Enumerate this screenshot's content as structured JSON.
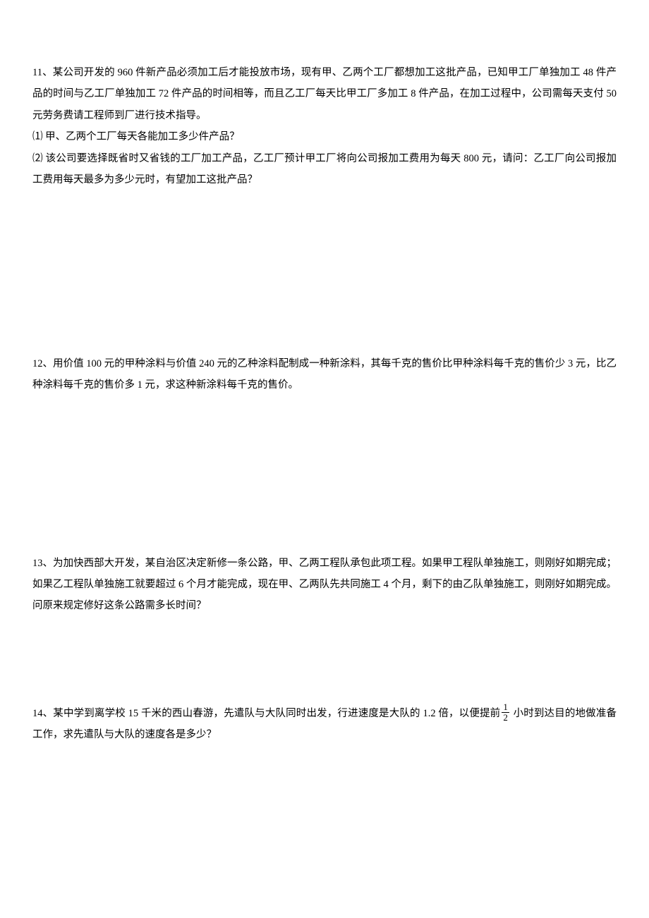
{
  "problems": {
    "p11": {
      "line1": "11、某公司开发的 960 件新产品必须加工后才能投放市场，现有甲、乙两个工厂都想加工这批产品，已知甲工厂单独加工 48 件产品的时间与乙工厂单独加工 72 件产品的时间相等，而且乙工厂每天比甲工厂多加工 8 件产品，在加工过程中，公司需每天支付 50 元劳务费请工程师到厂进行技术指导。",
      "line2": "⑴ 甲、乙两个工厂每天各能加工多少件产品？",
      "line3": "⑵ 该公司要选择既省时又省钱的工厂加工产品，乙工厂预计甲工厂将向公司报加工费用为每天 800 元，请问：乙工厂向公司报加工费用每天最多为多少元时，有望加工这批产品？"
    },
    "p12": {
      "line1": "12、用价值 100 元的甲种涂料与价值 240 元的乙种涂料配制成一种新涂料，其每千克的售价比甲种涂料每千克的售价少 3 元，比乙种涂料每千克的售价多 1 元，求这种新涂料每千克的售价。"
    },
    "p13": {
      "line1": "13、为加快西部大开发，某自治区决定新修一条公路，甲、乙两工程队承包此项工程。如果甲工程队单独施工，则刚好如期完成；如果乙工程队单独施工就要超过 6 个月才能完成，现在甲、乙两队先共同施工 4 个月，剩下的由乙队单独施工，则刚好如期完成。问原来规定修好这条公路需多长时间？"
    },
    "p14": {
      "part1": "14、某中学到离学校 15 千米的西山春游，先遣队与大队同时出发，行进速度是大队的 1.2 倍，以便提前",
      "frac_num": "1",
      "frac_den": "2",
      "part2": " 小时到达目的地做准备工作，求先遣队与大队的速度各是多少？"
    }
  }
}
